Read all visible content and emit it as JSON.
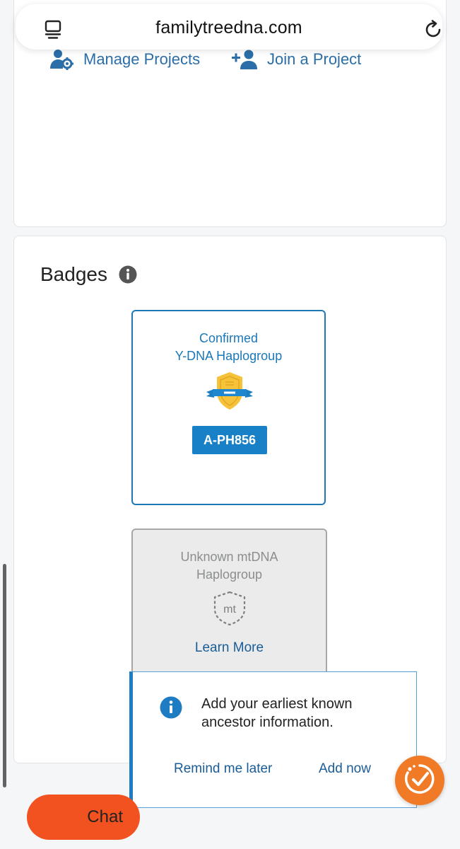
{
  "browser": {
    "url": "familytreedna.com",
    "tabs_icon": "tabs-icon",
    "reload_icon": "reload-icon"
  },
  "projects": {
    "manage_label": "Manage Projects",
    "manage_icon": "user-gear-icon",
    "join_label": "Join a Project",
    "join_icon": "add-user-icon"
  },
  "badges": {
    "title": "Badges",
    "info_icon": "info-icon",
    "confirmed": {
      "line1": "Confirmed",
      "line2": "Y-DNA Haplogroup",
      "icon": "gold-shield-icon",
      "haplogroup": "A-PH856"
    },
    "unknown": {
      "line1": "Unknown mtDNA",
      "line2": "Haplogroup",
      "icon_text": "mt",
      "link": "Learn More"
    }
  },
  "popup": {
    "message": "Add your earliest known ancestor information.",
    "remind_label": "Remind me later",
    "add_label": "Add now"
  },
  "chat": {
    "label": "Chat"
  },
  "colors": {
    "link_blue": "#2b6ea8",
    "accent_blue": "#1780c6",
    "chat_orange": "#f2521f",
    "check_orange": "#f07a26",
    "gold": "#f5c23a"
  }
}
